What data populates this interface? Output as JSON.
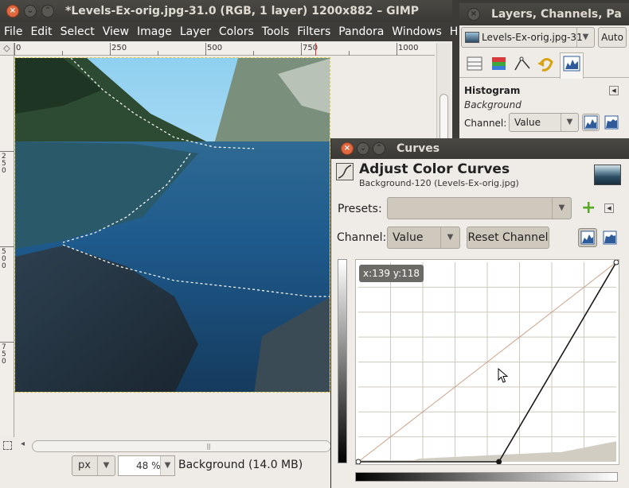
{
  "main_window": {
    "title": "*Levels-Ex-orig.jpg-31.0 (RGB, 1 layer) 1200x882 – GIMP",
    "menu": [
      "File",
      "Edit",
      "Select",
      "View",
      "Image",
      "Layer",
      "Colors",
      "Tools",
      "Filters",
      "Pandora",
      "Windows",
      "Help"
    ],
    "h_ruler_labels": [
      "0",
      "250",
      "500",
      "750",
      "1000"
    ],
    "v_ruler_labels": [
      "2\n5\n0",
      "5\n0\n0",
      "7\n5\n0"
    ],
    "status": {
      "unit": "px",
      "zoom": "48 %",
      "layer_info": "Background (14.0 MB)"
    }
  },
  "dock": {
    "title": "Layers, Channels, Pa",
    "image_selector": "Levels-Ex-orig.jpg-31",
    "auto_label": "Auto",
    "tabs": [
      "layers-tab",
      "channels-tab",
      "paths-tab",
      "undo-tab",
      "histogram-tab"
    ],
    "histogram": {
      "title": "Histogram",
      "layer": "Background",
      "channel_label": "Channel:",
      "channel_value": "Value"
    }
  },
  "curves": {
    "window_title": "Curves",
    "heading": "Adjust Color Curves",
    "subheading": "Background-120 (Levels-Ex-orig.jpg)",
    "presets_label": "Presets:",
    "presets_value": "",
    "channel_label": "Channel:",
    "channel_value": "Value",
    "reset_label": "Reset Channel",
    "coord_readout": "x:139 y:118",
    "points": [
      [
        0,
        0
      ],
      [
        139,
        0
      ],
      [
        255,
        255
      ]
    ]
  },
  "colors": {
    "titlebar": "#3c3b37",
    "close_button": "#e0693f",
    "accent_green": "#5aa827"
  }
}
